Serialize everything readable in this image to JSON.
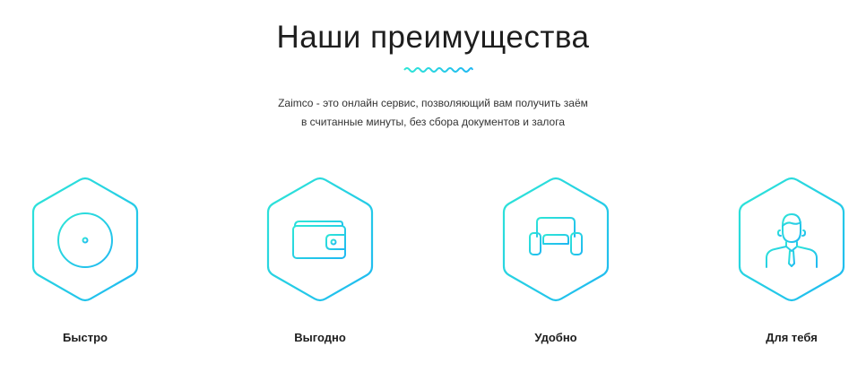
{
  "section": {
    "title": "Наши преимущества",
    "description_line1": "Zaimco - это онлайн сервис, позволяющий вам получить заём",
    "description_line2": "в считанные минуты, без сбора документов и залога"
  },
  "features": [
    {
      "label": "Быстро",
      "icon": "clock-icon"
    },
    {
      "label": "Выгодно",
      "icon": "wallet-icon"
    },
    {
      "label": "Удобно",
      "icon": "armchair-icon"
    },
    {
      "label": "Для тебя",
      "icon": "person-icon"
    }
  ],
  "colors": {
    "accent_start": "#2ee6d6",
    "accent_end": "#1fb8f2"
  }
}
